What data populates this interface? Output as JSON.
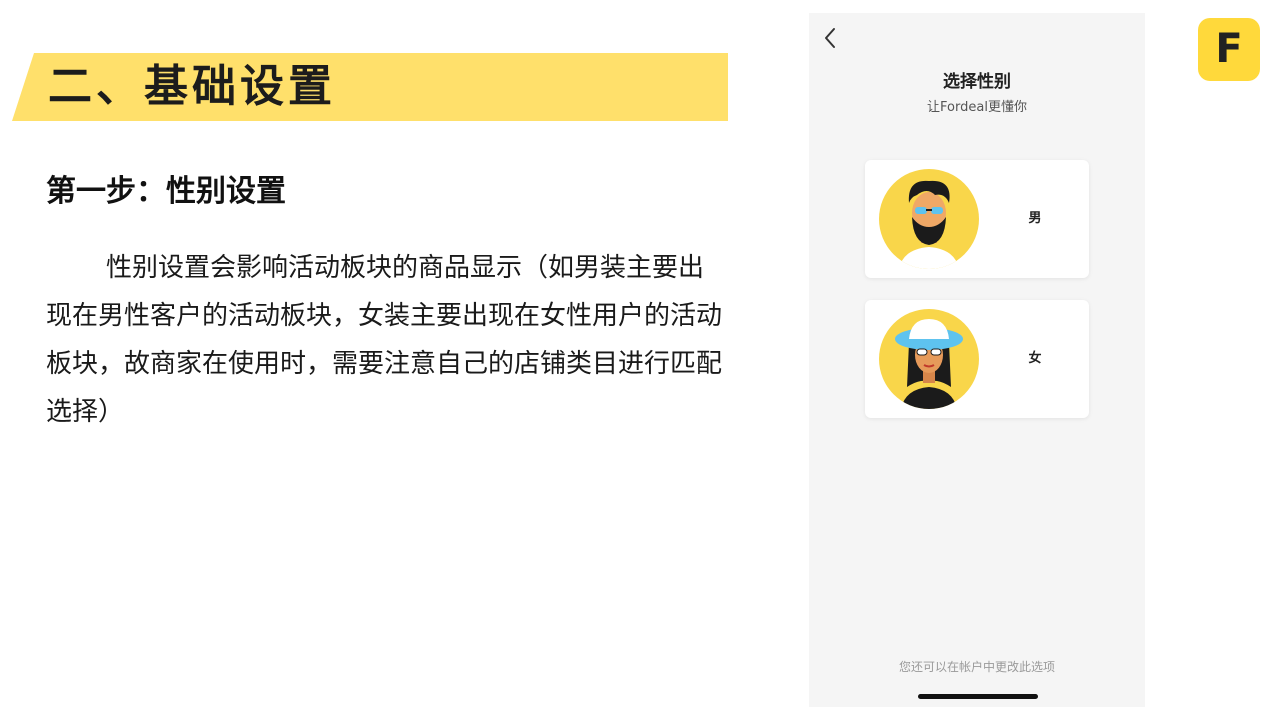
{
  "slide": {
    "section_title": "二、基础设置",
    "step_title": "第一步：性别设置",
    "body": "性别设置会影响活动板块的商品显示（如男装主要出现在男性客户的活动板块，女装主要出现在女性用户的活动板块，故商家在使用时，需要注意自己的店铺类目进行匹配选择）"
  },
  "logo": {
    "letter": "F",
    "color": "#FFD93B"
  },
  "phone": {
    "title": "选择性别",
    "subtitle": "让Fordeal更懂你",
    "options": [
      {
        "label": "男",
        "icon": "male-avatar-icon"
      },
      {
        "label": "女",
        "icon": "female-avatar-icon"
      }
    ],
    "footer": "您还可以在帐户中更改此选项"
  },
  "colors": {
    "accent": "#FFE06B",
    "avatar_bg": "#F9D64A",
    "phone_bg": "#F5F5F5"
  }
}
